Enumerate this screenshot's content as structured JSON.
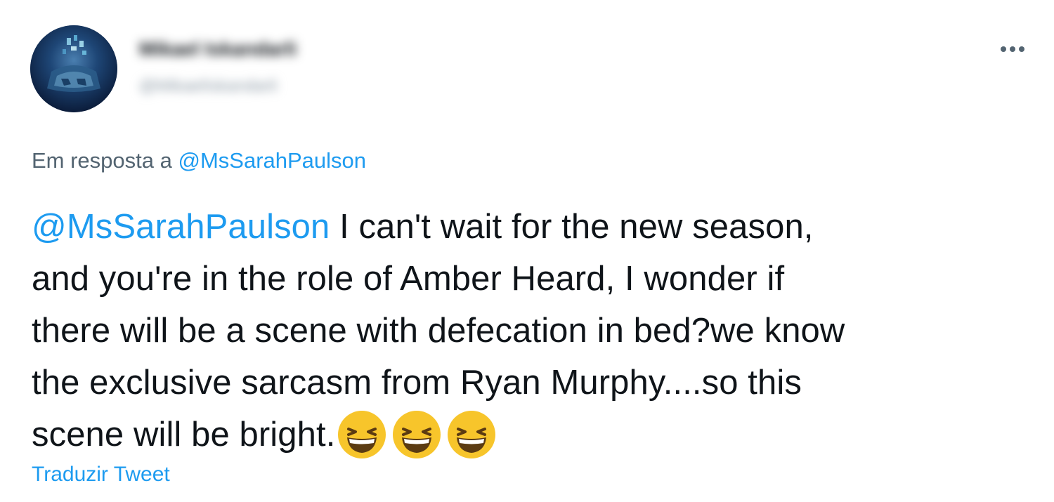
{
  "author": {
    "display_name": "Mikael Iskandarli",
    "handle": "@MikaelIskandarli"
  },
  "reply_context": {
    "prefix": "Em resposta a ",
    "mention": "@MsSarahPaulson"
  },
  "tweet": {
    "mention": "@MsSarahPaulson",
    "lines": [
      " I can't wait for the new season,",
      "and you're in the role of Amber Heard, I wonder if",
      "there will be a scene with defecation in bed?we know",
      "the exclusive sarcasm from Ryan Murphy....so this",
      "scene will be bright."
    ],
    "emojis": [
      "grinning-squinting-face",
      "grinning-squinting-face",
      "grinning-squinting-face"
    ]
  },
  "translate_label": "Traduzir Tweet",
  "icons": {
    "more": "more-horizontal-icon"
  },
  "colors": {
    "link": "#1d9bf0",
    "text": "#0f1419",
    "secondary": "#536471",
    "emoji": "#f7c52b"
  }
}
